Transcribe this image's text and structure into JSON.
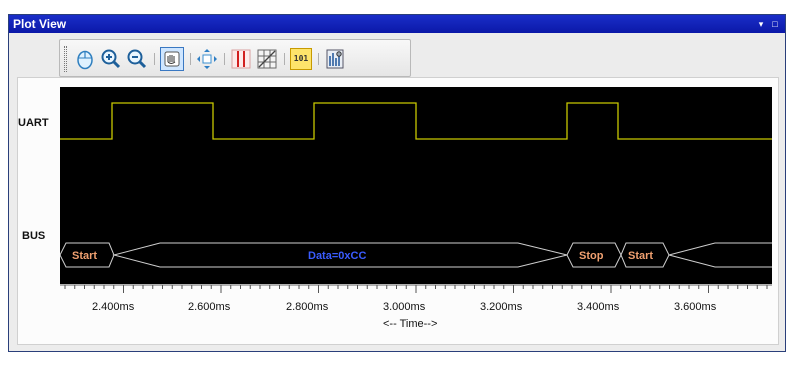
{
  "window": {
    "title": "Plot View",
    "controls": [
      "▾",
      "□"
    ]
  },
  "toolbar": {
    "tools": [
      {
        "name": "mouse-select-icon",
        "active": false
      },
      {
        "name": "zoom-in-icon",
        "active": false
      },
      {
        "name": "zoom-out-icon",
        "active": false
      },
      {
        "name": "pan-hand-icon",
        "active": true
      },
      {
        "name": "fit-view-icon",
        "active": false
      },
      {
        "name": "cursor-markers-icon",
        "active": false
      },
      {
        "name": "grid-icon",
        "active": false
      },
      {
        "name": "binary-display-icon",
        "active": false,
        "text": "101"
      },
      {
        "name": "settings-icon",
        "active": false
      }
    ]
  },
  "channels": [
    {
      "label": "UART"
    },
    {
      "label": "BUS"
    }
  ],
  "bus_segments": [
    {
      "label": "Start",
      "type": "control"
    },
    {
      "label": "Data=0xCC",
      "type": "data"
    },
    {
      "label": "Stop",
      "type": "control"
    },
    {
      "label": "Start",
      "type": "control"
    }
  ],
  "axis": {
    "title": "<-- Time-->",
    "ticks": [
      "2.400ms",
      "2.600ms",
      "2.800ms",
      "3.000ms",
      "3.200ms",
      "3.400ms",
      "3.600ms"
    ]
  },
  "colors": {
    "uart_trace": "#c8c800",
    "bus_outline": "#cfcfcf",
    "control_text": "#f0a070",
    "data_text": "#3a5cff",
    "titlebar": "#0b18c0"
  }
}
